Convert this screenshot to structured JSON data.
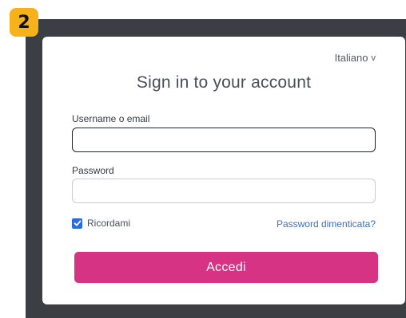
{
  "step_badge": "2",
  "language": {
    "selected": "Italiano",
    "chevron": "v"
  },
  "title": "Sign in to your account",
  "username": {
    "label": "Username o email",
    "value": ""
  },
  "password": {
    "label": "Password",
    "value": ""
  },
  "remember_me": {
    "label": "Ricordami",
    "checked": true
  },
  "forgot_password": "Password dimenticata?",
  "submit_label": "Accedi",
  "colors": {
    "badge": "#f5b21a",
    "frame": "#3b3f43",
    "submit": "#d63384",
    "link": "#3a6fc4",
    "checkbox": "#2d6cdf"
  }
}
